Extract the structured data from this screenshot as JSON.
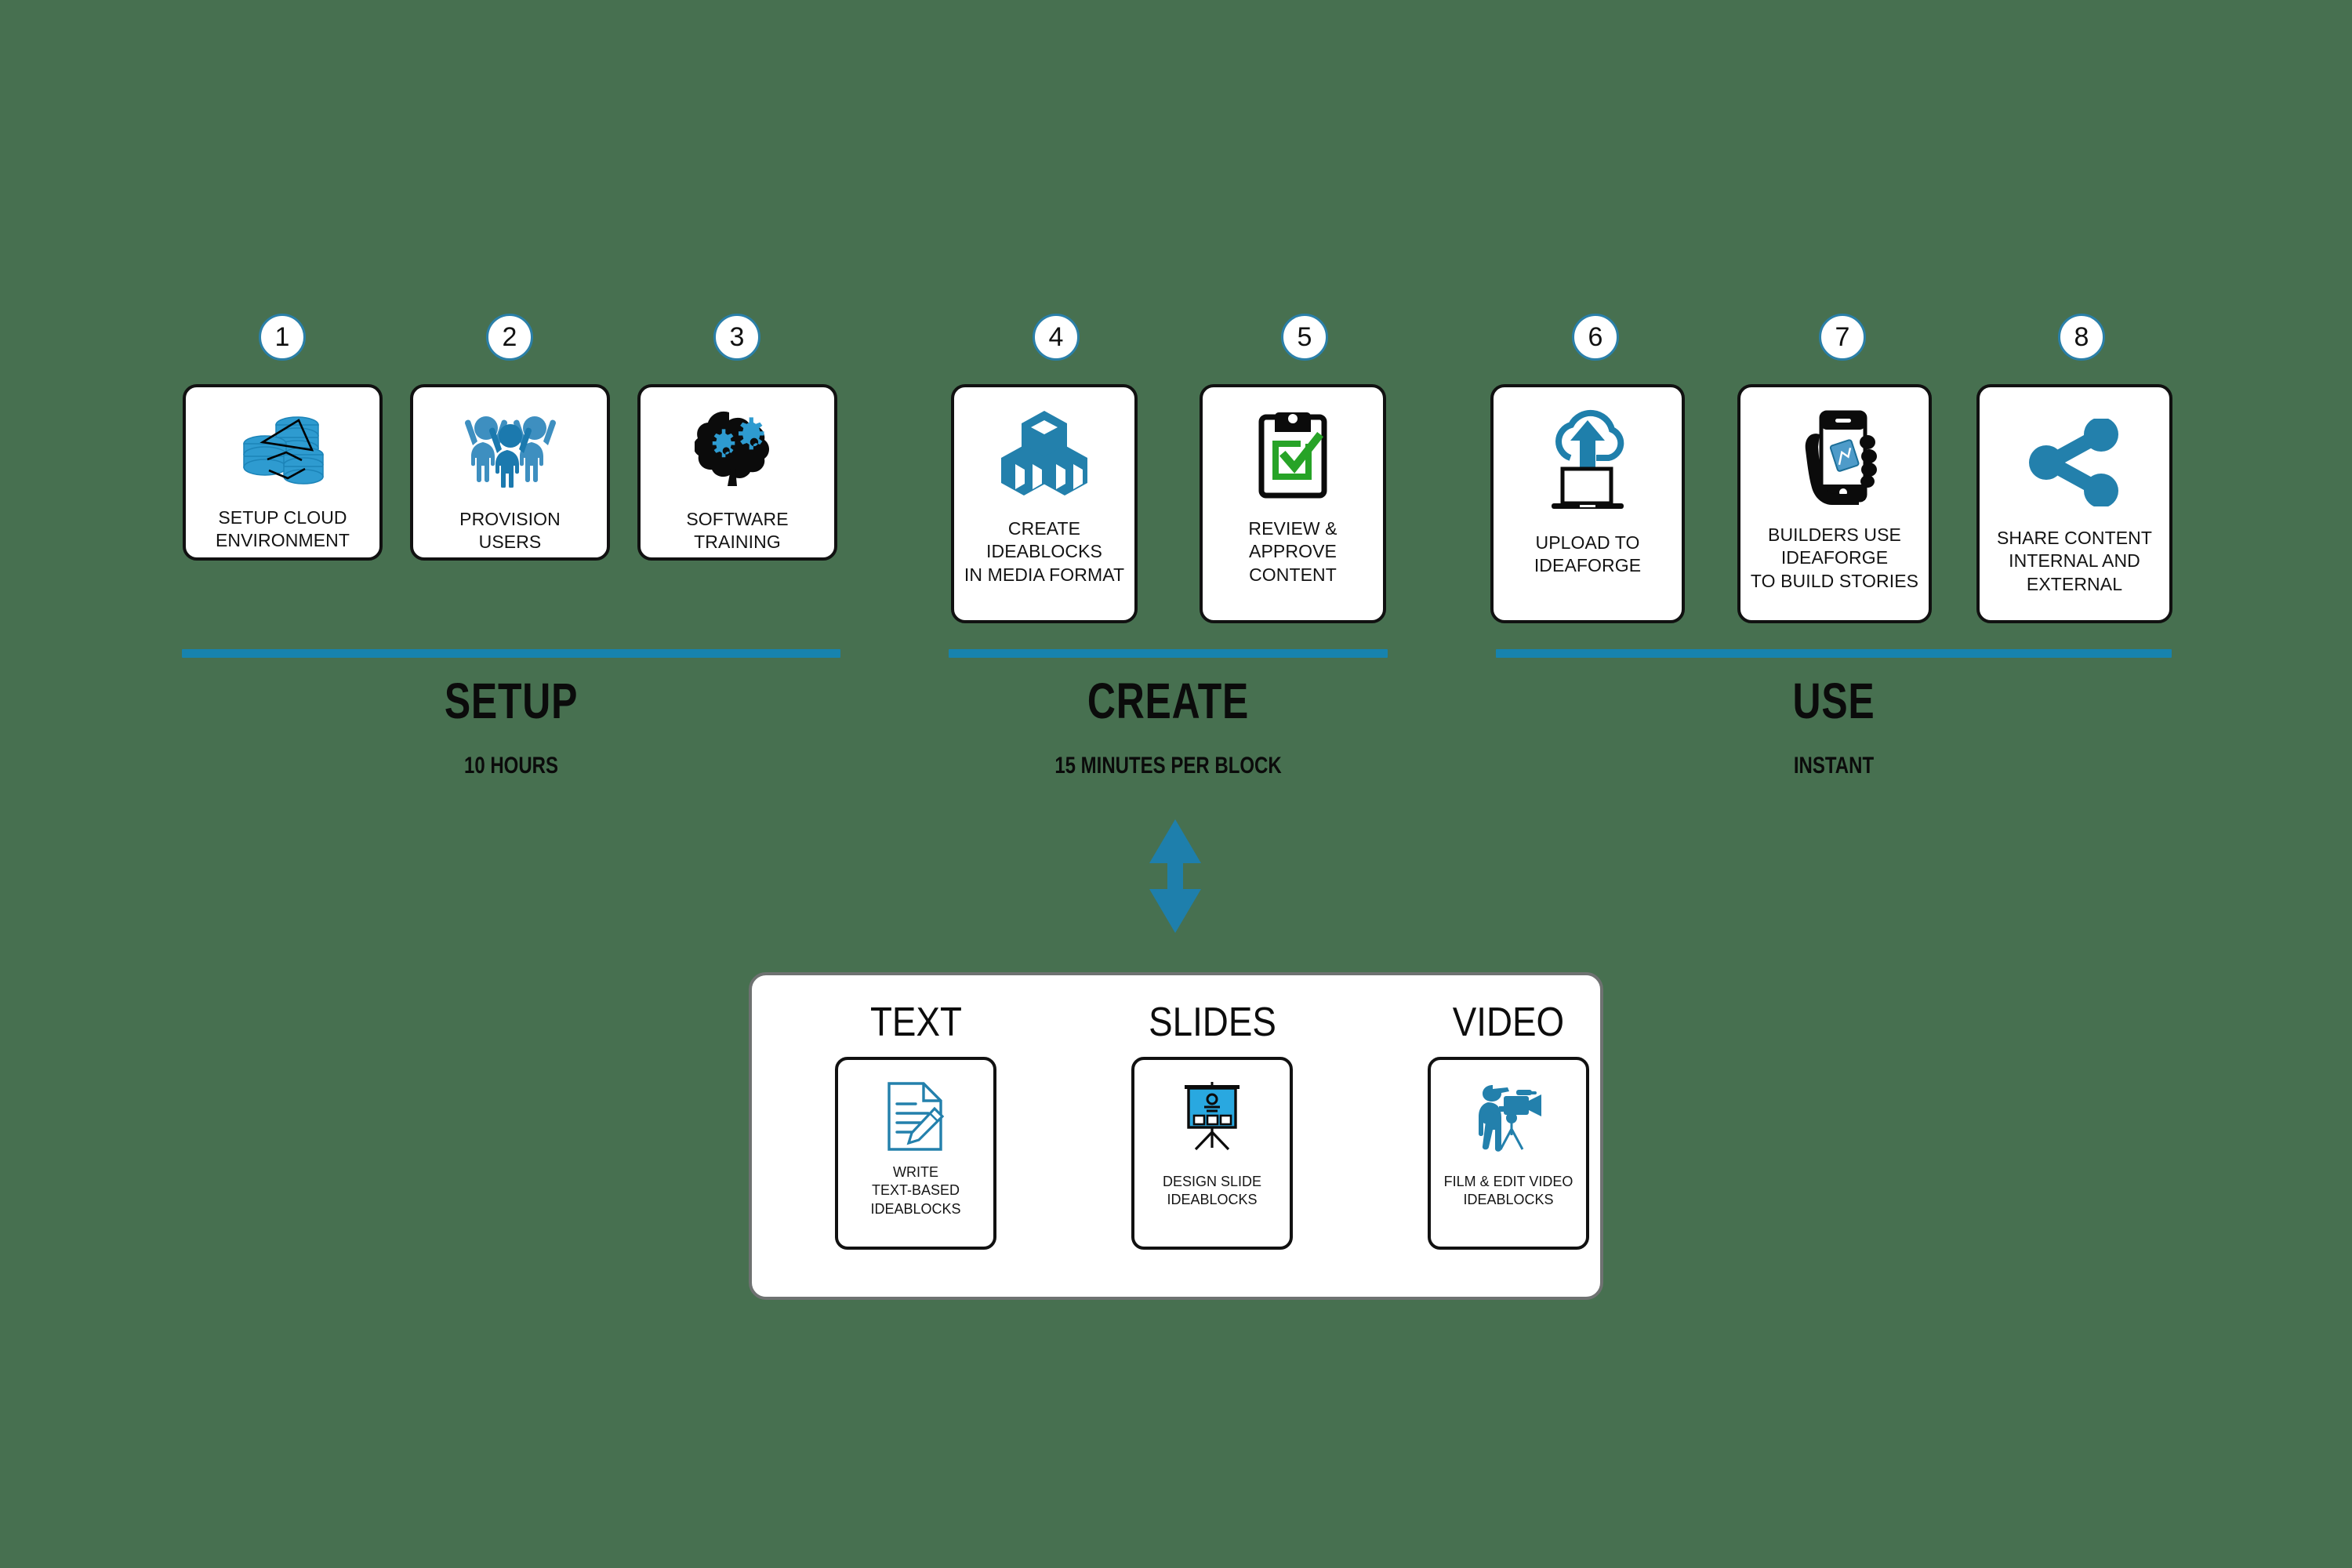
{
  "colors": {
    "background": "#477050",
    "accent_blue": "#1783AE",
    "icon_blue": "#2081B0",
    "icon_light_blue": "#29A8E0",
    "check_green": "#27A327",
    "card_border": "#111111",
    "panel_border": "#6E7271"
  },
  "sections": [
    {
      "id": "setup",
      "title": "SETUP",
      "subtitle": "10 HOURS",
      "steps": [
        {
          "number": "1",
          "label": "SETUP CLOUD\nENVIRONMENT",
          "icon": "database-stack-icon"
        },
        {
          "number": "2",
          "label": "PROVISION\nUSERS",
          "icon": "people-group-icon"
        },
        {
          "number": "3",
          "label": "SOFTWARE\nTRAINING",
          "icon": "brain-gears-icon"
        }
      ]
    },
    {
      "id": "create",
      "title": "CREATE",
      "subtitle": "15 MINUTES PER BLOCK",
      "steps": [
        {
          "number": "4",
          "label": "CREATE\nIDEABLOCKS\nIN MEDIA FORMAT",
          "icon": "blocks-cubes-icon"
        },
        {
          "number": "5",
          "label": "REVIEW &\nAPPROVE\nCONTENT",
          "icon": "clipboard-check-icon"
        }
      ]
    },
    {
      "id": "use",
      "title": "USE",
      "subtitle": "INSTANT",
      "steps": [
        {
          "number": "6",
          "label": "UPLOAD TO\nIDEAFORGE",
          "icon": "cloud-upload-laptop-icon"
        },
        {
          "number": "7",
          "label": "BUILDERS USE\nIDEAFORGE\nTO BUILD STORIES",
          "icon": "hand-phone-icon"
        },
        {
          "number": "8",
          "label": "SHARE CONTENT\nINTERNAL AND\nEXTERNAL",
          "icon": "share-nodes-icon"
        }
      ]
    }
  ],
  "connector": {
    "icon": "double-headed-vertical-arrow-icon"
  },
  "media_panel": {
    "columns": [
      {
        "title": "TEXT",
        "label": "WRITE\nTEXT-BASED\nIDEABLOCKS",
        "icon": "document-pencil-icon"
      },
      {
        "title": "SLIDES",
        "label": "DESIGN SLIDE\nIDEABLOCKS",
        "icon": "presentation-board-icon"
      },
      {
        "title": "VIDEO",
        "label": "FILM & EDIT VIDEO\nIDEABLOCKS",
        "icon": "videographer-camera-icon"
      }
    ]
  }
}
